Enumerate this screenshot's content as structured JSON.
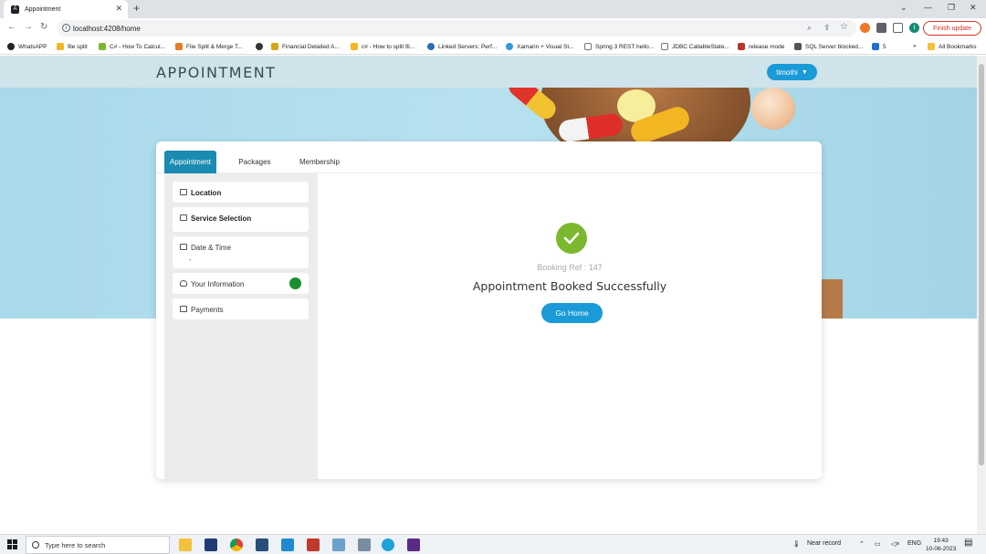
{
  "browser": {
    "tab_title": "Appointment",
    "url": "localhost:4208/home",
    "finish_update_label": "Finish update",
    "profile_initial": "t",
    "bookmarks": [
      "WhatsAPP",
      "file split",
      "C# - How To Calcul...",
      "File Split & Merge T...",
      "Financial Detailed A...",
      "c# - How to split fil...",
      "Linked Servers: Perf...",
      "Xamarin + Visual St...",
      "Spring 3 REST hello...",
      "JDBC CallableState...",
      "release mode",
      "SQL Server blocked...",
      "5",
      "All Bookmarks"
    ]
  },
  "header": {
    "brand": "APPOINTMENT",
    "user_label": "timothi"
  },
  "tabs": [
    "Appointment",
    "Packages",
    "Membership"
  ],
  "steps": [
    {
      "label": "Location",
      "sub": ""
    },
    {
      "label": "Service Selection",
      "sub": ""
    },
    {
      "label": "Date & Time",
      "sub": "-"
    },
    {
      "label": "Your Information",
      "sub": ""
    },
    {
      "label": "Payments",
      "sub": ""
    }
  ],
  "confirmation": {
    "booking_ref": "Booking Ref : 147",
    "message": "Appointment Booked Successfully",
    "button": "Go Home"
  },
  "taskbar": {
    "search_placeholder": "Type here to search",
    "weather": "Near record",
    "lang": "ENG",
    "time": "19:43",
    "date": "10-06-2023"
  },
  "colors": {
    "accent": "#1a9ad6",
    "tab_active": "#1a8bb1",
    "success": "#7cb82f",
    "status_dot": "#1a8f2e"
  }
}
